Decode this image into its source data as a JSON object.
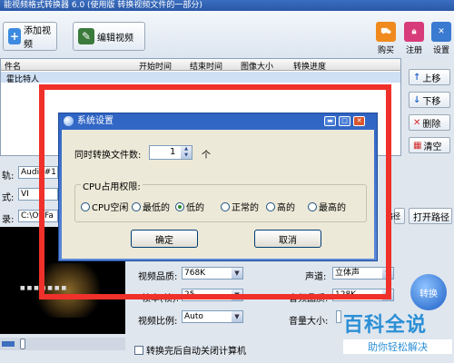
{
  "window": {
    "title": "能视频格式转换器 6.0 (使用版 转换视频文件的一部分)"
  },
  "toolbar": {
    "add_video": "添加视频",
    "edit_video": "编辑视频",
    "buy": "购买",
    "register": "注册",
    "settings": "设置"
  },
  "filelist": {
    "headers": [
      "件名",
      "开始时间",
      "结束时间",
      "图像大小",
      "转换进度"
    ],
    "row": "霍比特人"
  },
  "side_buttons": {
    "up": "上移",
    "down": "下移",
    "delete": "删除",
    "clear": "清空"
  },
  "left_panel": {
    "track_label": "轨:",
    "track_value": "Audio#1",
    "format_label": "式:",
    "format_value": "VI",
    "dir_label": "录:",
    "dir_value": "C:\\Ot\\Fa"
  },
  "right_panel": {
    "browse": "路径",
    "open_path": "打开路径"
  },
  "settings": {
    "video_quality_label": "视频品质:",
    "video_quality_value": "768K",
    "frame_rate_label": "帧率(帧):",
    "frame_rate_value": "25",
    "aspect_label": "视频比例:",
    "aspect_value": "Auto",
    "channel_label": "声道:",
    "channel_value": "立体声",
    "audio_quality_label": "音频品质:",
    "audio_quality_value": "128K",
    "volume_label": "音量大小:",
    "convert": "转换"
  },
  "shutdown": "转换完后自动关闭计算机",
  "dialog": {
    "title": "系统设置",
    "concurrent_label": "同时转换文件数:",
    "concurrent_value": "1",
    "concurrent_unit": "个",
    "cpu_group": "CPU占用权限:",
    "options": [
      "CPU空闲",
      "最低的",
      "低的",
      "正常的",
      "高的",
      "最高的"
    ],
    "selected": "低的",
    "ok": "确定",
    "cancel": "取消"
  },
  "watermark": {
    "title": "百科全说",
    "subtitle": "助你轻松解决"
  }
}
